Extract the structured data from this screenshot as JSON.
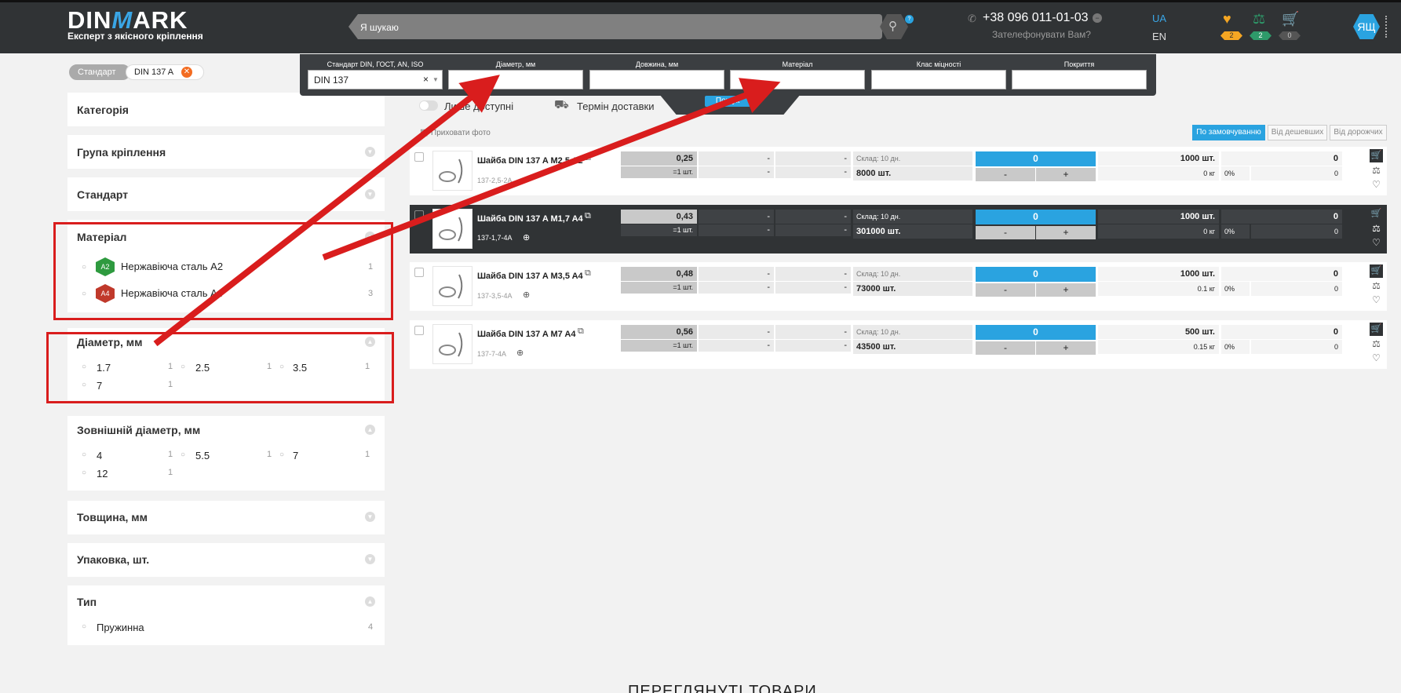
{
  "header": {
    "logo": {
      "left": "DIN",
      "mark": "M",
      "right": "ARK"
    },
    "tagline": "Експерт з якісного кріплення",
    "search_placeholder": "Я шукаю",
    "phone": "+38 096 011-01-03",
    "callback": "Зателефонувати Вам?",
    "lang_active": "UA",
    "lang_other": "EN",
    "favorites_count": "2",
    "compare_count": "2",
    "cart_count": "0",
    "user_initials": "ЯЩ"
  },
  "breadcrumb": {
    "first": "Стандарт",
    "second": "DIN 137 A"
  },
  "filters_bar": {
    "standard": {
      "label": "Стандарт DIN, ГОСТ, AN, ISO",
      "value": "DIN 137"
    },
    "diameter": {
      "label": "Діаметр, мм",
      "value": ""
    },
    "length": {
      "label": "Довжина, мм",
      "value": ""
    },
    "material": {
      "label": "Матеріал",
      "value": ""
    },
    "strength": {
      "label": "Клас міцності",
      "value": ""
    },
    "coating": {
      "label": "Покриття",
      "value": ""
    }
  },
  "sidebar": {
    "category": "Категорія",
    "group": "Група кріплення",
    "standard": "Стандарт",
    "material": {
      "title": "Матеріал",
      "options": [
        {
          "badge": "A2",
          "label": "Нержавіюча сталь А2",
          "count": "1",
          "color": "#2e9a3f"
        },
        {
          "badge": "A4",
          "label": "Нержавіюча сталь А4",
          "count": "3",
          "color": "#c0392b"
        }
      ]
    },
    "diameter": {
      "title": "Діаметр, мм",
      "options": [
        {
          "label": "1.7",
          "count": "1"
        },
        {
          "label": "2.5",
          "count": "1"
        },
        {
          "label": "3.5",
          "count": "1"
        },
        {
          "label": "7",
          "count": "1"
        }
      ]
    },
    "outer_diameter": {
      "title": "Зовнішній діаметр, мм",
      "options": [
        {
          "label": "4",
          "count": "1"
        },
        {
          "label": "5.5",
          "count": "1"
        },
        {
          "label": "7",
          "count": "1"
        },
        {
          "label": "12",
          "count": "1"
        }
      ]
    },
    "thickness": "Товщина, мм",
    "packaging": "Упаковка, шт.",
    "type": {
      "title": "Тип",
      "option": "Пружинна",
      "count": "4"
    }
  },
  "toolbar": {
    "only_available": "Лише доступні",
    "delivery": "Термін доставки",
    "search_btn": "Пошук",
    "hide_photo": "Приховати фото",
    "sort_default": "По замовчуванню",
    "sort_cheap": "Від дешевших",
    "sort_expensive": "Від дорожчих"
  },
  "products": [
    {
      "name": "Шайба DIN 137 A M2,5 A2",
      "code": "137-2,5-2А",
      "price": "0,25",
      "per": "=1 шт.",
      "p2": "-",
      "p3": "-",
      "warehouse": "Склад: 10 дн.",
      "stock": "8000 шт.",
      "qty": "0",
      "minus": "-",
      "plus": "+",
      "pack": "1000 шт.",
      "weight": "0 кг",
      "discount": "0%",
      "sum": "0",
      "sum2": "0"
    },
    {
      "name": "Шайба DIN 137 A M1,7 A4",
      "code": "137-1,7-4А",
      "price": "0,43",
      "per": "=1 шт.",
      "p2": "-",
      "p3": "-",
      "warehouse": "Склад: 10 дн.",
      "stock": "301000 шт.",
      "qty": "0",
      "minus": "-",
      "plus": "+",
      "pack": "1000 шт.",
      "weight": "0 кг",
      "discount": "0%",
      "sum": "0",
      "sum2": "0"
    },
    {
      "name": "Шайба DIN 137 A M3,5 A4",
      "code": "137-3,5-4А",
      "price": "0,48",
      "per": "=1 шт.",
      "p2": "-",
      "p3": "-",
      "warehouse": "Склад: 10 дн.",
      "stock": "73000 шт.",
      "qty": "0",
      "minus": "-",
      "plus": "+",
      "pack": "1000 шт.",
      "weight": "0.1 кг",
      "discount": "0%",
      "sum": "0",
      "sum2": "0"
    },
    {
      "name": "Шайба DIN 137 A M7 A4",
      "code": "137-7-4А",
      "price": "0,56",
      "per": "=1 шт.",
      "p2": "-",
      "p3": "-",
      "warehouse": "Склад: 10 дн.",
      "stock": "43500 шт.",
      "qty": "0",
      "minus": "-",
      "plus": "+",
      "pack": "500 шт.",
      "weight": "0.15 кг",
      "discount": "0%",
      "sum": "0",
      "sum2": "0"
    }
  ],
  "bottom_title": "ПЕРЕГЛЯНУТІ ТОВАРИ",
  "annotation_color": "#d91d1d"
}
